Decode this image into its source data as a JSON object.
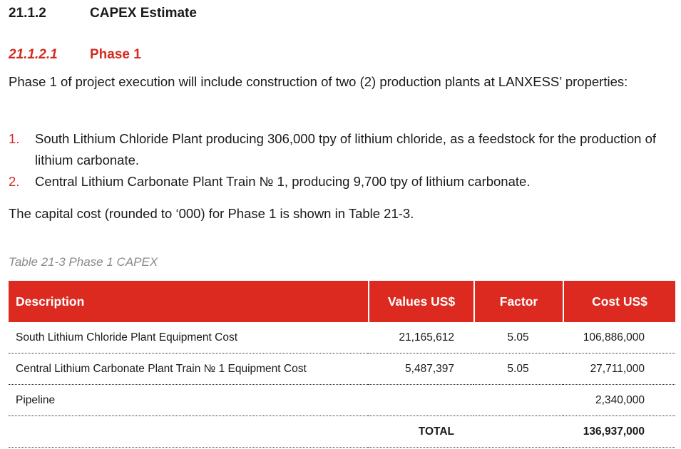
{
  "section": {
    "number": "21.1.2",
    "title": "CAPEX Estimate"
  },
  "subsection": {
    "number": "21.1.2.1",
    "title": "Phase 1"
  },
  "intro": "Phase 1 of project execution will include construction of two (2) production plants at LANXESS’ properties:",
  "list": [
    {
      "marker": "1.",
      "text": "South Lithium Chloride Plant producing 306,000 tpy of lithium chloride, as a feedstock for the production of lithium carbonate."
    },
    {
      "marker": "2.",
      "text": "Central Lithium Carbonate Plant Train № 1, producing 9,700 tpy of lithium carbonate."
    }
  ],
  "summary": "The capital cost (rounded to ‘000) for Phase 1 is shown in Table 21-3.",
  "table": {
    "caption": "Table 21-3 Phase 1 CAPEX",
    "headers": [
      "Description",
      "Values US$",
      "Factor",
      "Cost US$"
    ],
    "rows": [
      [
        "South Lithium Chloride Plant Equipment Cost",
        "21,165,612",
        "5.05",
        "106,886,000"
      ],
      [
        "Central Lithium Carbonate Plant Train № 1 Equipment Cost",
        "5,487,397",
        "5.05",
        "27,711,000"
      ],
      [
        "Pipeline",
        "",
        "",
        "2,340,000"
      ]
    ],
    "total_label": "TOTAL",
    "total_value": "136,937,000"
  },
  "colors": {
    "accent": "#dc2a20",
    "heading_red": "#d42a1f",
    "caption_gray": "#8a8a8a"
  }
}
